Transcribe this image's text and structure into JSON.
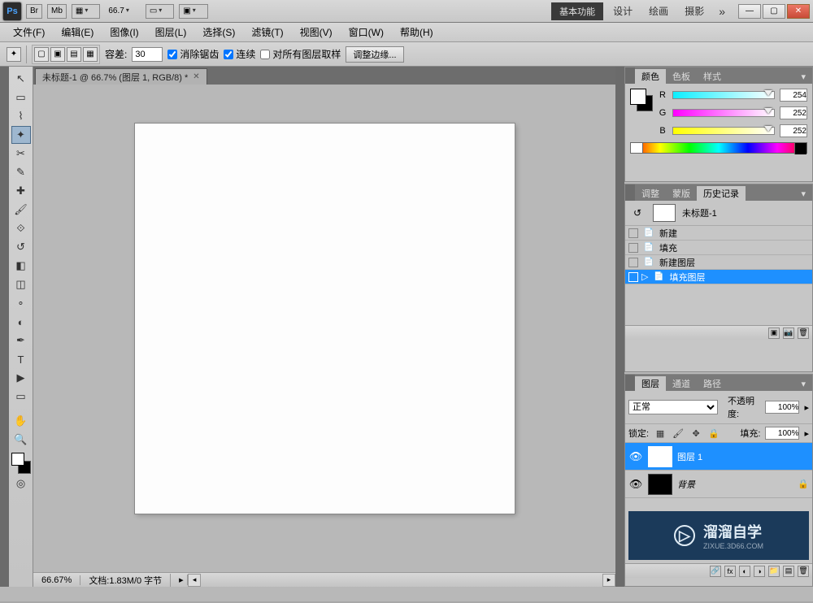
{
  "titlebar": {
    "logo": "Ps",
    "chips": [
      "Br",
      "Mb"
    ],
    "zoom": "66.7",
    "workspace_default": "基本功能",
    "workspaces": [
      "设计",
      "绘画",
      "摄影"
    ],
    "more": "»"
  },
  "menu": [
    "文件(F)",
    "编辑(E)",
    "图像(I)",
    "图层(L)",
    "选择(S)",
    "滤镜(T)",
    "视图(V)",
    "窗口(W)",
    "帮助(H)"
  ],
  "options": {
    "tolerance_label": "容差:",
    "tolerance": "30",
    "antialias": "消除锯齿",
    "contiguous": "连续",
    "all_layers": "对所有图层取样",
    "refine_edge": "调整边缘..."
  },
  "document": {
    "tab": "未标题-1 @ 66.7% (图层 1, RGB/8) *",
    "status_zoom": "66.67%",
    "status_doc": "文档:1.83M/0 字节"
  },
  "color_panel": {
    "tabs": [
      "颜色",
      "色板",
      "样式"
    ],
    "channels": [
      {
        "label": "R",
        "value": "254"
      },
      {
        "label": "G",
        "value": "252"
      },
      {
        "label": "B",
        "value": "252"
      }
    ]
  },
  "history_panel": {
    "tabs": [
      "调整",
      "蒙版",
      "历史记录"
    ],
    "doc_name": "未标题-1",
    "items": [
      "新建",
      "填充",
      "新建图层",
      "填充图层"
    ],
    "selected_index": 3
  },
  "layers_panel": {
    "tabs": [
      "图层",
      "通道",
      "路径"
    ],
    "blend_mode": "正常",
    "opacity_label": "不透明度:",
    "opacity": "100%",
    "lock_label": "锁定:",
    "fill_label": "填充:",
    "fill": "100%",
    "layers": [
      {
        "name": "图层 1",
        "thumb": "white",
        "selected": true,
        "locked": false
      },
      {
        "name": "背景",
        "thumb": "black",
        "selected": false,
        "locked": true,
        "italic": true
      }
    ]
  },
  "watermark": {
    "main": "溜溜自学",
    "sub": "ZIXUE.3D66.COM"
  }
}
